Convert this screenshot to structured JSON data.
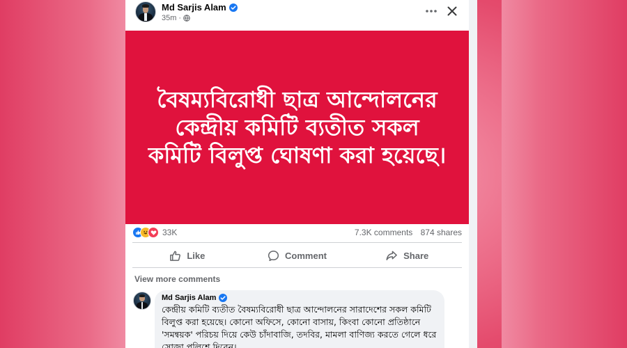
{
  "post": {
    "author": "Md Sarjis Alam",
    "verified": true,
    "time": "35m",
    "audience_icon": "globe-icon"
  },
  "banner": {
    "text": "বৈষম্যবিরোধী ছাত্র আন্দোলনের কেন্দ্রীয় কমিটি ব্যতীত সকল কমিটি বিলুপ্ত ঘোষণা করা হয়েছে।",
    "background_color": "#e0123d",
    "text_color": "#ffffff"
  },
  "stats": {
    "reactions": [
      "like",
      "haha",
      "love"
    ],
    "reaction_count": "33K",
    "comments": "7.3K comments",
    "shares": "874 shares"
  },
  "actions": {
    "like": "Like",
    "comment": "Comment",
    "share": "Share"
  },
  "view_more_comments": "View more comments",
  "comment": {
    "author": "Md Sarjis Alam",
    "verified": true,
    "text": "কেন্দ্রীয় কমিটি ব্যতীত বৈষম্যবিরোধী ছাত্র আন্দোলনের সারাদেশের সকল কমিটি বিলুপ্ত করা হয়েছে। কোনো অফিসে, কোনো বাসায়, কিংবা কোনো প্রতিষ্ঠানে 'সমন্বয়ক' পরিচয় দিয়ে কেউ চাঁদাবাজি, তদবির, মামলা বাণিজ্য করতে গেলে ধরে সোজা পুলিশে দিবেন।"
  },
  "colors": {
    "brand_blue": "#1877f2",
    "secondary_text": "#65676b",
    "page_background": "#e44a6c"
  }
}
